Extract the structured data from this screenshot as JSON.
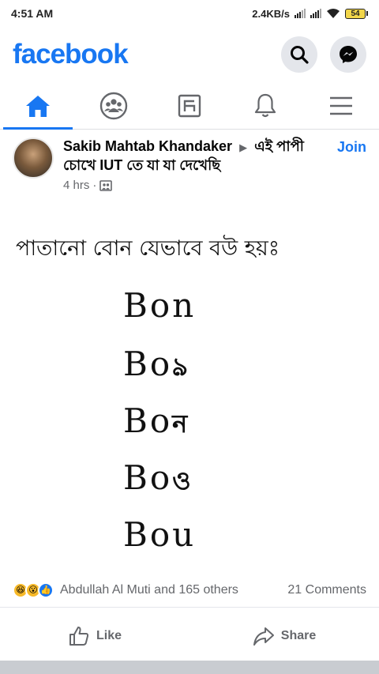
{
  "status_bar": {
    "time": "4:51 AM",
    "net_speed": "2.4KB/s",
    "battery": "54"
  },
  "header": {
    "logo": "facebook",
    "search_icon": "search-icon",
    "messenger_icon": "messenger-icon"
  },
  "tabs": [
    {
      "icon": "home-icon",
      "active": true
    },
    {
      "icon": "groups-icon",
      "active": false
    },
    {
      "icon": "watch-icon",
      "active": false
    },
    {
      "icon": "bell-icon",
      "active": false
    },
    {
      "icon": "menu-icon",
      "active": false
    }
  ],
  "post": {
    "author": "Sakib Mahtab Khandaker",
    "group": "এই পাপী চোখে IUT তে যা যা দেখেছি",
    "time": "4 hrs",
    "join_label": "Join",
    "image": {
      "title": "পাতানো বোন যেভাবে বউ হয়ঃ",
      "lines": [
        {
          "base": "Bon",
          "tail": ""
        },
        {
          "base": "Bo",
          "tail": "ঌ"
        },
        {
          "base": "Bo",
          "tail": "ন"
        },
        {
          "base": "Bo",
          "tail": "ও"
        },
        {
          "base": "Bou",
          "tail": ""
        }
      ]
    },
    "reactions_text": "Abdullah Al Muti and 165 others",
    "comments_text": "21 Comments",
    "like_label": "Like",
    "share_label": "Share"
  },
  "colors": {
    "brand": "#1877f2",
    "muted": "#65676b"
  }
}
